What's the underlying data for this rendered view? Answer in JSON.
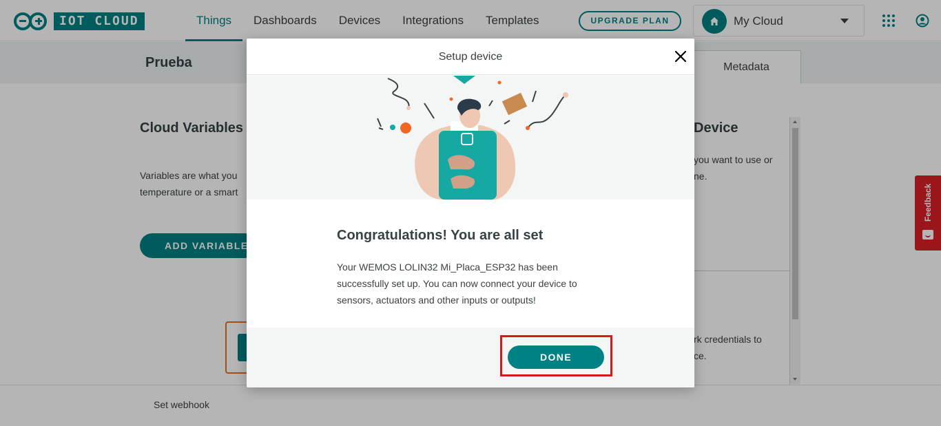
{
  "app": {
    "logo_text": "IOT CLOUD"
  },
  "nav": {
    "items": [
      {
        "label": "Things",
        "active": true
      },
      {
        "label": "Dashboards",
        "active": false
      },
      {
        "label": "Devices",
        "active": false
      },
      {
        "label": "Integrations",
        "active": false
      },
      {
        "label": "Templates",
        "active": false
      }
    ],
    "upgrade_label": "UPGRADE PLAN",
    "space_label": "My Cloud"
  },
  "page": {
    "thing_name": "Prueba",
    "metadata_tab": "Metadata",
    "cloud_variables_title": "Cloud Variables",
    "variables_text_line1": "Variables are what you",
    "variables_text_line2": "temperature or a smart",
    "add_variable_label": "ADD VARIABLE",
    "device_title": "Device",
    "device_text_line1": "you want to use or",
    "device_text_line2": "ne.",
    "network_text_line1": "rk credentials to",
    "network_text_line2": "ce.",
    "webhook_label": "Set webhook",
    "feedback_label": "Feedback"
  },
  "modal": {
    "title": "Setup device",
    "heading": "Congratulations! You are all set",
    "message_line1": "Your WEMOS LOLIN32 Mi_Placa_ESP32 has been",
    "message_line2": "successfully set up. You can now connect your device to",
    "message_line3": "sensors, actuators and other inputs or outputs!",
    "done_label": "DONE"
  },
  "colors": {
    "accent": "#008184",
    "highlight": "#d21c1c",
    "feedback": "#da1f26",
    "illustration_teal": "#16a8a3"
  },
  "icons": [
    "home-icon",
    "caret-down-icon",
    "apps-grid-icon",
    "user-account-icon",
    "close-icon",
    "feedback-icon"
  ]
}
